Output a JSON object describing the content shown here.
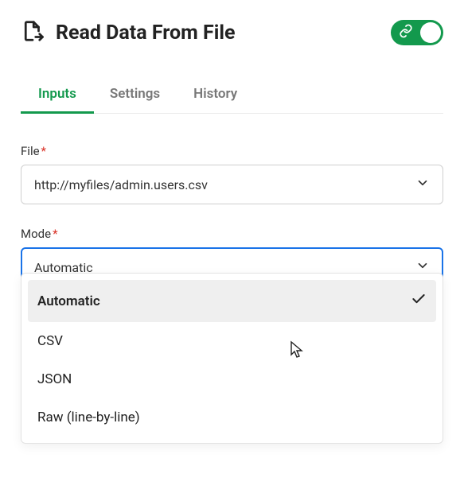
{
  "header": {
    "title": "Read Data From File",
    "toggle_on": true
  },
  "tabs": [
    {
      "label": "Inputs",
      "active": true
    },
    {
      "label": "Settings",
      "active": false
    },
    {
      "label": "History",
      "active": false
    }
  ],
  "file_field": {
    "label": "File",
    "required": "*",
    "value": "http://myfiles/admin.users.csv"
  },
  "mode_field": {
    "label": "Mode",
    "required": "*",
    "value": "Automatic",
    "options": [
      {
        "label": "Automatic",
        "selected": true
      },
      {
        "label": "CSV",
        "selected": false
      },
      {
        "label": "JSON",
        "selected": false
      },
      {
        "label": "Raw (line-by-line)",
        "selected": false
      }
    ]
  }
}
